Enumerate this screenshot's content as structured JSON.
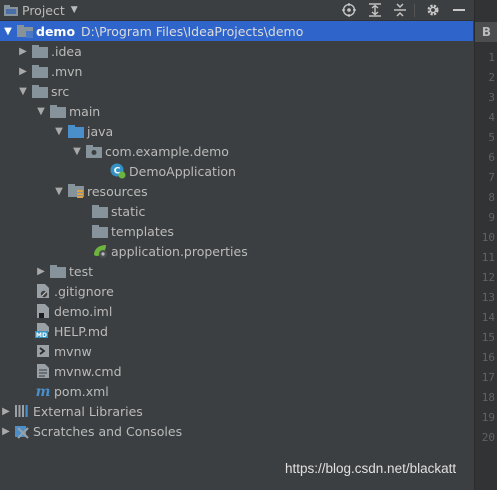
{
  "panel": {
    "title": "Project",
    "toolbar": [
      "locate-icon",
      "expand-all-icon",
      "collapse-all-icon",
      "gear-icon",
      "hide-icon"
    ]
  },
  "tree": [
    {
      "label": "demo",
      "path": "D:\\Program Files\\IdeaProjects\\demo",
      "icon": "module-folder-icon",
      "expanded": true
    },
    {
      "label": ".idea",
      "icon": "folder-icon",
      "expanded": false
    },
    {
      "label": ".mvn",
      "icon": "folder-icon",
      "expanded": false
    },
    {
      "label": "src",
      "icon": "folder-icon",
      "expanded": true
    },
    {
      "label": "main",
      "icon": "folder-icon",
      "expanded": true
    },
    {
      "label": "java",
      "icon": "source-folder-icon",
      "expanded": true
    },
    {
      "label": "com.example.demo",
      "icon": "package-icon",
      "expanded": true
    },
    {
      "label": "DemoApplication",
      "icon": "spring-class-icon"
    },
    {
      "label": "resources",
      "icon": "resources-folder-icon",
      "expanded": true
    },
    {
      "label": "static",
      "icon": "folder-icon"
    },
    {
      "label": "templates",
      "icon": "folder-icon"
    },
    {
      "label": "application.properties",
      "icon": "spring-properties-icon"
    },
    {
      "label": "test",
      "icon": "folder-icon",
      "expanded": false
    },
    {
      "label": ".gitignore",
      "icon": "ignore-file-icon"
    },
    {
      "label": "demo.iml",
      "icon": "iml-file-icon"
    },
    {
      "label": "HELP.md",
      "icon": "markdown-file-icon"
    },
    {
      "label": "mvnw",
      "icon": "script-file-icon"
    },
    {
      "label": "mvnw.cmd",
      "icon": "text-file-icon"
    },
    {
      "label": "pom.xml",
      "icon": "maven-icon"
    },
    {
      "label": "External Libraries",
      "icon": "libraries-icon",
      "expanded": false
    },
    {
      "label": "Scratches and Consoles",
      "icon": "scratches-icon",
      "expanded": false
    }
  ],
  "editor_gutter": {
    "tab_label": "B",
    "line_numbers": [
      "1",
      "2",
      "3",
      "4",
      "5",
      "6",
      "7",
      "8",
      "9",
      "10",
      "11",
      "12",
      "13",
      "14",
      "15",
      "16",
      "17",
      "18",
      "19",
      "20"
    ]
  },
  "watermark": "https://blog.csdn.net/blackatt"
}
